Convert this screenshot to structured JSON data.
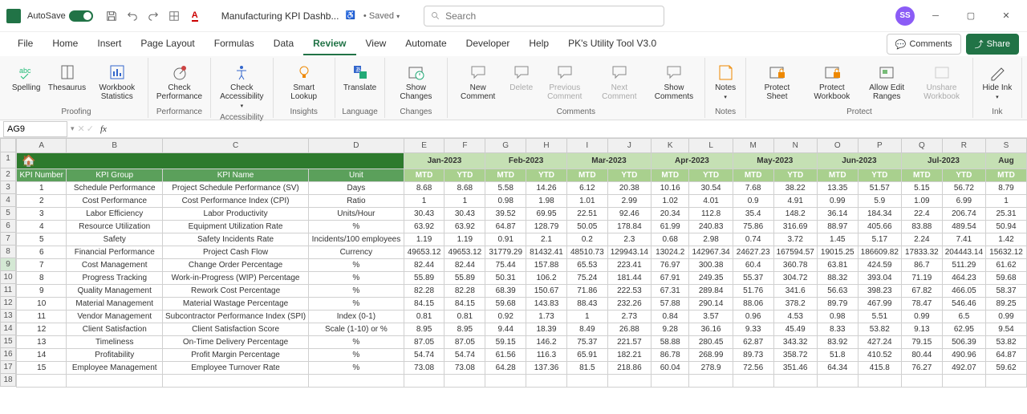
{
  "titlebar": {
    "autosave": "AutoSave",
    "filename": "Manufacturing KPI Dashb...",
    "saved": "• Saved",
    "search_placeholder": "Search",
    "avatar": "SS"
  },
  "tabs": [
    "File",
    "Home",
    "Insert",
    "Page Layout",
    "Formulas",
    "Data",
    "Review",
    "View",
    "Automate",
    "Developer",
    "Help",
    "PK's Utility Tool V3.0"
  ],
  "active_tab": "Review",
  "ribbon_right": {
    "comments": "Comments",
    "share": "Share"
  },
  "ribbon_groups": [
    {
      "label": "Proofing",
      "items": [
        {
          "label": "Spelling",
          "icon": "abc"
        },
        {
          "label": "Thesaurus",
          "icon": "book"
        },
        {
          "label": "Workbook Statistics",
          "icon": "stats"
        }
      ]
    },
    {
      "label": "Performance",
      "items": [
        {
          "label": "Check Performance",
          "icon": "perf"
        }
      ]
    },
    {
      "label": "Accessibility",
      "items": [
        {
          "label": "Check Accessibility",
          "icon": "acc",
          "dropdown": true
        }
      ]
    },
    {
      "label": "Insights",
      "items": [
        {
          "label": "Smart Lookup",
          "icon": "bulb"
        }
      ]
    },
    {
      "label": "Language",
      "items": [
        {
          "label": "Translate",
          "icon": "trans"
        }
      ]
    },
    {
      "label": "Changes",
      "items": [
        {
          "label": "Show Changes",
          "icon": "clock"
        }
      ]
    },
    {
      "label": "Comments",
      "items": [
        {
          "label": "New Comment",
          "icon": "comment"
        },
        {
          "label": "Delete",
          "icon": "comment",
          "disabled": true
        },
        {
          "label": "Previous Comment",
          "icon": "comment",
          "disabled": true
        },
        {
          "label": "Next Comment",
          "icon": "comment",
          "disabled": true
        },
        {
          "label": "Show Comments",
          "icon": "comment"
        }
      ]
    },
    {
      "label": "Notes",
      "items": [
        {
          "label": "Notes",
          "icon": "note",
          "dropdown": true
        }
      ]
    },
    {
      "label": "Protect",
      "items": [
        {
          "label": "Protect Sheet",
          "icon": "lock"
        },
        {
          "label": "Protect Workbook",
          "icon": "lock"
        },
        {
          "label": "Allow Edit Ranges",
          "icon": "ranges"
        },
        {
          "label": "Unshare Workbook",
          "icon": "unshare",
          "disabled": true
        }
      ]
    },
    {
      "label": "Ink",
      "items": [
        {
          "label": "Hide Ink",
          "icon": "pen",
          "dropdown": true
        }
      ]
    }
  ],
  "name_box": "AG9",
  "columns": [
    "A",
    "B",
    "C",
    "D",
    "E",
    "F",
    "G",
    "H",
    "I",
    "J",
    "K",
    "L",
    "M",
    "N",
    "O",
    "P",
    "Q",
    "R",
    "S"
  ],
  "months": [
    "Jan-2023",
    "Feb-2023",
    "Mar-2023",
    "Apr-2023",
    "May-2023",
    "Jun-2023",
    "Jul-2023",
    "Aug"
  ],
  "sub": [
    "MTD",
    "YTD"
  ],
  "headers": [
    "KPI Number",
    "KPI Group",
    "KPI Name",
    "Unit"
  ],
  "rows": [
    {
      "n": "1",
      "g": "Schedule Performance",
      "k": "Project Schedule Performance (SV)",
      "u": "Days",
      "v": [
        "8.68",
        "8.68",
        "5.58",
        "14.26",
        "6.12",
        "20.38",
        "10.16",
        "30.54",
        "7.68",
        "38.22",
        "13.35",
        "51.57",
        "5.15",
        "56.72",
        "8.79"
      ]
    },
    {
      "n": "2",
      "g": "Cost Performance",
      "k": "Cost Performance Index (CPI)",
      "u": "Ratio",
      "v": [
        "1",
        "1",
        "0.98",
        "1.98",
        "1.01",
        "2.99",
        "1.02",
        "4.01",
        "0.9",
        "4.91",
        "0.99",
        "5.9",
        "1.09",
        "6.99",
        "1"
      ]
    },
    {
      "n": "3",
      "g": "Labor Efficiency",
      "k": "Labor Productivity",
      "u": "Units/Hour",
      "v": [
        "30.43",
        "30.43",
        "39.52",
        "69.95",
        "22.51",
        "92.46",
        "20.34",
        "112.8",
        "35.4",
        "148.2",
        "36.14",
        "184.34",
        "22.4",
        "206.74",
        "25.31"
      ]
    },
    {
      "n": "4",
      "g": "Resource Utilization",
      "k": "Equipment Utilization Rate",
      "u": "%",
      "v": [
        "63.92",
        "63.92",
        "64.87",
        "128.79",
        "50.05",
        "178.84",
        "61.99",
        "240.83",
        "75.86",
        "316.69",
        "88.97",
        "405.66",
        "83.88",
        "489.54",
        "50.94"
      ]
    },
    {
      "n": "5",
      "g": "Safety",
      "k": "Safety Incidents Rate",
      "u": "Incidents/100 employees",
      "v": [
        "1.19",
        "1.19",
        "0.91",
        "2.1",
        "0.2",
        "2.3",
        "0.68",
        "2.98",
        "0.74",
        "3.72",
        "1.45",
        "5.17",
        "2.24",
        "7.41",
        "1.42"
      ]
    },
    {
      "n": "6",
      "g": "Financial Performance",
      "k": "Project Cash Flow",
      "u": "Currency",
      "v": [
        "49653.12",
        "49653.12",
        "31779.29",
        "81432.41",
        "48510.73",
        "129943.14",
        "13024.2",
        "142967.34",
        "24627.23",
        "167594.57",
        "19015.25",
        "186609.82",
        "17833.32",
        "204443.14",
        "15632.12"
      ]
    },
    {
      "n": "7",
      "g": "Cost Management",
      "k": "Change Order Percentage",
      "u": "%",
      "v": [
        "82.44",
        "82.44",
        "75.44",
        "157.88",
        "65.53",
        "223.41",
        "76.97",
        "300.38",
        "60.4",
        "360.78",
        "63.81",
        "424.59",
        "86.7",
        "511.29",
        "61.62"
      ]
    },
    {
      "n": "8",
      "g": "Progress Tracking",
      "k": "Work-in-Progress (WIP) Percentage",
      "u": "%",
      "v": [
        "55.89",
        "55.89",
        "50.31",
        "106.2",
        "75.24",
        "181.44",
        "67.91",
        "249.35",
        "55.37",
        "304.72",
        "88.32",
        "393.04",
        "71.19",
        "464.23",
        "59.68"
      ]
    },
    {
      "n": "9",
      "g": "Quality Management",
      "k": "Rework Cost Percentage",
      "u": "%",
      "v": [
        "82.28",
        "82.28",
        "68.39",
        "150.67",
        "71.86",
        "222.53",
        "67.31",
        "289.84",
        "51.76",
        "341.6",
        "56.63",
        "398.23",
        "67.82",
        "466.05",
        "58.37"
      ]
    },
    {
      "n": "10",
      "g": "Material Management",
      "k": "Material Wastage Percentage",
      "u": "%",
      "v": [
        "84.15",
        "84.15",
        "59.68",
        "143.83",
        "88.43",
        "232.26",
        "57.88",
        "290.14",
        "88.06",
        "378.2",
        "89.79",
        "467.99",
        "78.47",
        "546.46",
        "89.25"
      ]
    },
    {
      "n": "11",
      "g": "Vendor Management",
      "k": "Subcontractor Performance Index (SPI)",
      "u": "Index (0-1)",
      "v": [
        "0.81",
        "0.81",
        "0.92",
        "1.73",
        "1",
        "2.73",
        "0.84",
        "3.57",
        "0.96",
        "4.53",
        "0.98",
        "5.51",
        "0.99",
        "6.5",
        "0.99"
      ]
    },
    {
      "n": "12",
      "g": "Client Satisfaction",
      "k": "Client Satisfaction Score",
      "u": "Scale (1-10) or %",
      "v": [
        "8.95",
        "8.95",
        "9.44",
        "18.39",
        "8.49",
        "26.88",
        "9.28",
        "36.16",
        "9.33",
        "45.49",
        "8.33",
        "53.82",
        "9.13",
        "62.95",
        "9.54"
      ]
    },
    {
      "n": "13",
      "g": "Timeliness",
      "k": "On-Time Delivery Percentage",
      "u": "%",
      "v": [
        "87.05",
        "87.05",
        "59.15",
        "146.2",
        "75.37",
        "221.57",
        "58.88",
        "280.45",
        "62.87",
        "343.32",
        "83.92",
        "427.24",
        "79.15",
        "506.39",
        "53.82"
      ]
    },
    {
      "n": "14",
      "g": "Profitability",
      "k": "Profit Margin Percentage",
      "u": "%",
      "v": [
        "54.74",
        "54.74",
        "61.56",
        "116.3",
        "65.91",
        "182.21",
        "86.78",
        "268.99",
        "89.73",
        "358.72",
        "51.8",
        "410.52",
        "80.44",
        "490.96",
        "64.87"
      ]
    },
    {
      "n": "15",
      "g": "Employee Management",
      "k": "Employee Turnover Rate",
      "u": "%",
      "v": [
        "73.08",
        "73.08",
        "64.28",
        "137.36",
        "81.5",
        "218.86",
        "60.04",
        "278.9",
        "72.56",
        "351.46",
        "64.34",
        "415.8",
        "76.27",
        "492.07",
        "59.62"
      ]
    }
  ]
}
